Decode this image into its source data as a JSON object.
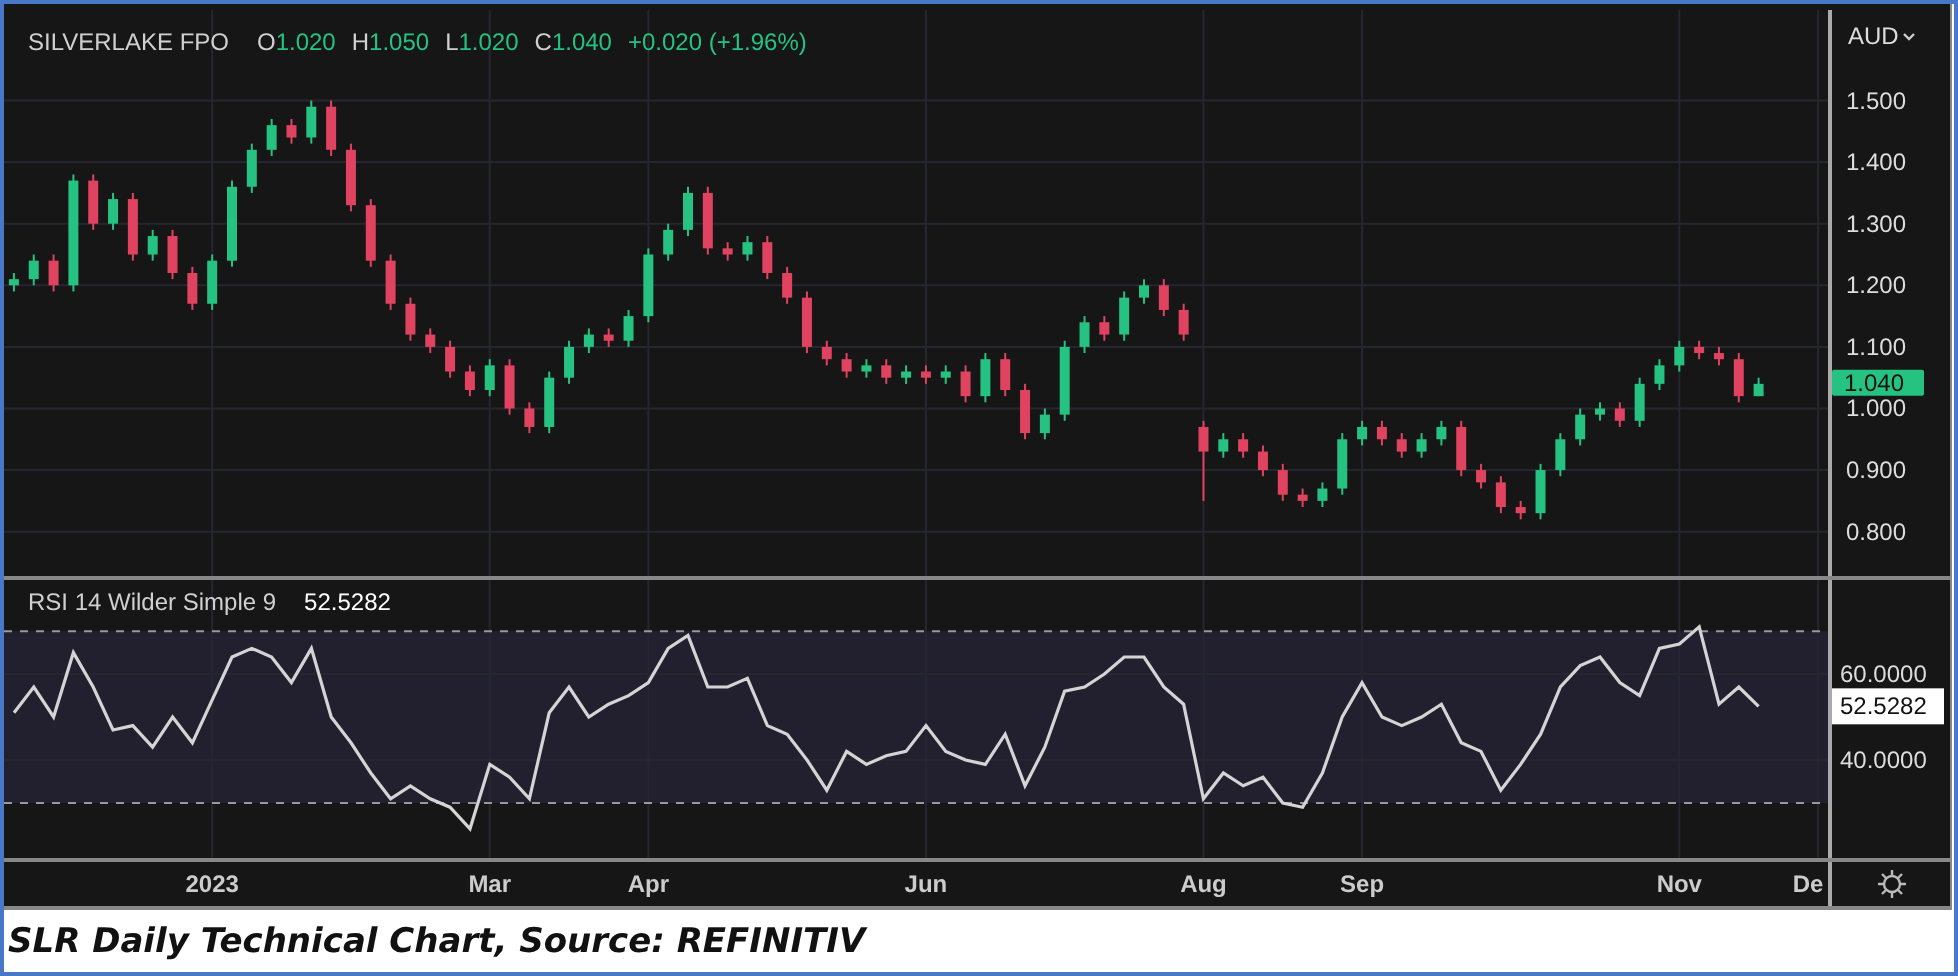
{
  "price_panel": {
    "symbol": "SILVERLAKE FPO",
    "ohlc": [
      {
        "label": "O",
        "value": "1.020"
      },
      {
        "label": "H",
        "value": "1.050"
      },
      {
        "label": "L",
        "value": "1.020"
      },
      {
        "label": "C",
        "value": "1.040"
      }
    ],
    "change": "+0.020 (+1.96%)",
    "currency": "AUD",
    "last_price": "1.040",
    "chart_data": {
      "type": "candlestick",
      "grid": true,
      "ylim": [
        0.728,
        1.647
      ],
      "yticks": [
        {
          "value": 0.8,
          "label": "0.800"
        },
        {
          "value": 0.9,
          "label": "0.900"
        },
        {
          "value": 1.0,
          "label": "1.000"
        },
        {
          "value": 1.1,
          "label": "1.100"
        },
        {
          "value": 1.2,
          "label": "1.200"
        },
        {
          "value": 1.3,
          "label": "1.300"
        },
        {
          "value": 1.4,
          "label": "1.400"
        },
        {
          "value": 1.5,
          "label": "1.500"
        }
      ],
      "categories": [
        null,
        null,
        null,
        null,
        null,
        null,
        null,
        null,
        null,
        null,
        null,
        null,
        null,
        null,
        null,
        null,
        null,
        null,
        null,
        null,
        null,
        null,
        null,
        null,
        null,
        null,
        null,
        null,
        null,
        null,
        null,
        null,
        null,
        null,
        null,
        null,
        null,
        null,
        null,
        null,
        null,
        null,
        null,
        null,
        null,
        null,
        null,
        null,
        null,
        null,
        null,
        null,
        null,
        null,
        null,
        null,
        null,
        null,
        null,
        null,
        null,
        null,
        null,
        null,
        null,
        null,
        null,
        null,
        null,
        null,
        null,
        null,
        null,
        null,
        null,
        null,
        null,
        null,
        null,
        null,
        null,
        null,
        null,
        null,
        null,
        null,
        null,
        null,
        null,
        null,
        null,
        null
      ],
      "ohlc": [
        [
          1.2,
          1.22,
          1.19,
          1.21
        ],
        [
          1.21,
          1.25,
          1.2,
          1.24
        ],
        [
          1.24,
          1.25,
          1.19,
          1.2
        ],
        [
          1.2,
          1.38,
          1.19,
          1.37
        ],
        [
          1.37,
          1.38,
          1.29,
          1.3
        ],
        [
          1.3,
          1.35,
          1.29,
          1.34
        ],
        [
          1.34,
          1.35,
          1.24,
          1.25
        ],
        [
          1.25,
          1.29,
          1.24,
          1.28
        ],
        [
          1.28,
          1.29,
          1.21,
          1.22
        ],
        [
          1.22,
          1.23,
          1.16,
          1.17
        ],
        [
          1.17,
          1.25,
          1.16,
          1.24
        ],
        [
          1.24,
          1.37,
          1.23,
          1.36
        ],
        [
          1.36,
          1.43,
          1.35,
          1.42
        ],
        [
          1.42,
          1.47,
          1.41,
          1.46
        ],
        [
          1.46,
          1.47,
          1.43,
          1.44
        ],
        [
          1.44,
          1.5,
          1.43,
          1.49
        ],
        [
          1.49,
          1.5,
          1.41,
          1.42
        ],
        [
          1.42,
          1.43,
          1.32,
          1.33
        ],
        [
          1.33,
          1.34,
          1.23,
          1.24
        ],
        [
          1.24,
          1.25,
          1.16,
          1.17
        ],
        [
          1.17,
          1.18,
          1.11,
          1.12
        ],
        [
          1.12,
          1.13,
          1.09,
          1.1
        ],
        [
          1.1,
          1.11,
          1.05,
          1.06
        ],
        [
          1.06,
          1.07,
          1.02,
          1.03
        ],
        [
          1.03,
          1.08,
          1.02,
          1.07
        ],
        [
          1.07,
          1.08,
          0.99,
          1.0
        ],
        [
          1.0,
          1.01,
          0.96,
          0.97
        ],
        [
          0.97,
          1.06,
          0.96,
          1.05
        ],
        [
          1.05,
          1.11,
          1.04,
          1.1
        ],
        [
          1.1,
          1.13,
          1.09,
          1.12
        ],
        [
          1.12,
          1.13,
          1.1,
          1.11
        ],
        [
          1.11,
          1.16,
          1.1,
          1.15
        ],
        [
          1.15,
          1.26,
          1.14,
          1.25
        ],
        [
          1.25,
          1.3,
          1.24,
          1.29
        ],
        [
          1.29,
          1.36,
          1.28,
          1.35
        ],
        [
          1.35,
          1.36,
          1.25,
          1.26
        ],
        [
          1.26,
          1.27,
          1.24,
          1.25
        ],
        [
          1.25,
          1.28,
          1.24,
          1.27
        ],
        [
          1.27,
          1.28,
          1.21,
          1.22
        ],
        [
          1.22,
          1.23,
          1.17,
          1.18
        ],
        [
          1.18,
          1.19,
          1.09,
          1.1
        ],
        [
          1.1,
          1.11,
          1.07,
          1.08
        ],
        [
          1.08,
          1.09,
          1.05,
          1.06
        ],
        [
          1.06,
          1.08,
          1.05,
          1.07
        ],
        [
          1.07,
          1.08,
          1.04,
          1.05
        ],
        [
          1.05,
          1.07,
          1.04,
          1.06
        ],
        [
          1.06,
          1.07,
          1.04,
          1.05
        ],
        [
          1.05,
          1.07,
          1.04,
          1.06
        ],
        [
          1.06,
          1.07,
          1.01,
          1.02
        ],
        [
          1.02,
          1.09,
          1.01,
          1.08
        ],
        [
          1.08,
          1.09,
          1.02,
          1.03
        ],
        [
          1.03,
          1.04,
          0.95,
          0.96
        ],
        [
          0.96,
          1.0,
          0.95,
          0.99
        ],
        [
          0.99,
          1.11,
          0.98,
          1.1
        ],
        [
          1.1,
          1.15,
          1.09,
          1.14
        ],
        [
          1.14,
          1.15,
          1.11,
          1.12
        ],
        [
          1.12,
          1.19,
          1.11,
          1.18
        ],
        [
          1.18,
          1.21,
          1.17,
          1.2
        ],
        [
          1.2,
          1.21,
          1.15,
          1.16
        ],
        [
          1.16,
          1.17,
          1.11,
          1.12
        ],
        [
          0.97,
          0.98,
          0.85,
          0.93
        ],
        [
          0.93,
          0.96,
          0.92,
          0.95
        ],
        [
          0.95,
          0.96,
          0.92,
          0.93
        ],
        [
          0.93,
          0.94,
          0.89,
          0.9
        ],
        [
          0.9,
          0.91,
          0.85,
          0.86
        ],
        [
          0.86,
          0.87,
          0.84,
          0.85
        ],
        [
          0.85,
          0.88,
          0.84,
          0.87
        ],
        [
          0.87,
          0.96,
          0.86,
          0.95
        ],
        [
          0.95,
          0.98,
          0.94,
          0.97
        ],
        [
          0.97,
          0.98,
          0.94,
          0.95
        ],
        [
          0.95,
          0.96,
          0.92,
          0.93
        ],
        [
          0.93,
          0.96,
          0.92,
          0.95
        ],
        [
          0.95,
          0.98,
          0.94,
          0.97
        ],
        [
          0.97,
          0.98,
          0.89,
          0.9
        ],
        [
          0.9,
          0.91,
          0.87,
          0.88
        ],
        [
          0.88,
          0.89,
          0.83,
          0.84
        ],
        [
          0.84,
          0.85,
          0.82,
          0.83
        ],
        [
          0.83,
          0.91,
          0.82,
          0.9
        ],
        [
          0.9,
          0.96,
          0.89,
          0.95
        ],
        [
          0.95,
          1.0,
          0.94,
          0.99
        ],
        [
          0.99,
          1.01,
          0.98,
          1.0
        ],
        [
          1.0,
          1.01,
          0.97,
          0.98
        ],
        [
          0.98,
          1.05,
          0.97,
          1.04
        ],
        [
          1.04,
          1.08,
          1.03,
          1.07
        ],
        [
          1.07,
          1.11,
          1.06,
          1.1
        ],
        [
          1.1,
          1.11,
          1.08,
          1.09
        ],
        [
          1.09,
          1.1,
          1.07,
          1.08
        ],
        [
          1.08,
          1.09,
          1.01,
          1.02
        ],
        [
          1.02,
          1.05,
          1.02,
          1.04
        ],
        null,
        null,
        null
      ]
    }
  },
  "rsi_panel": {
    "title": "RSI 14 Wilder Simple 9",
    "reading": "52.5282",
    "last_value": "52.5282",
    "chart_data": {
      "type": "line",
      "grid": true,
      "ylim": [
        17.2,
        81.9
      ],
      "yticks": [
        {
          "value": 40,
          "label": "40.0000"
        },
        {
          "value": 60,
          "label": "60.0000"
        }
      ],
      "categories": [
        null,
        null,
        null,
        null,
        null,
        null,
        null,
        null,
        null,
        null,
        "2023",
        null,
        null,
        null,
        null,
        null,
        null,
        null,
        null,
        null,
        null,
        null,
        null,
        null,
        "Mar",
        null,
        null,
        null,
        null,
        null,
        null,
        null,
        "Apr",
        null,
        null,
        null,
        null,
        null,
        null,
        null,
        null,
        null,
        null,
        null,
        null,
        null,
        "Jun",
        null,
        null,
        null,
        null,
        null,
        null,
        null,
        null,
        null,
        null,
        null,
        null,
        null,
        "Aug",
        null,
        null,
        null,
        null,
        null,
        null,
        null,
        "Sep",
        null,
        null,
        null,
        null,
        null,
        null,
        null,
        null,
        null,
        null,
        null,
        null,
        null,
        null,
        null,
        "Nov",
        null,
        null,
        null,
        null,
        null,
        null,
        "De"
      ],
      "bands": [
        {
          "axis": "y",
          "from": 30,
          "to": 70
        }
      ],
      "ref_lines": [
        {
          "axis": "y",
          "value": 70
        },
        {
          "axis": "y",
          "value": 30
        }
      ],
      "series": [
        {
          "color": "#d4d4d4",
          "values": [
            51,
            57,
            50,
            65,
            57,
            47,
            48,
            43,
            50,
            44,
            54,
            64,
            66,
            64,
            58,
            66,
            50,
            44,
            37,
            31,
            34,
            31,
            29,
            24,
            39,
            36,
            31,
            51,
            57,
            50,
            53,
            55,
            58,
            66,
            69,
            57,
            57,
            59,
            48,
            46,
            40,
            33,
            42,
            39,
            41,
            42,
            48,
            42,
            40,
            39,
            46,
            34,
            43,
            56,
            57,
            60,
            64,
            64,
            57,
            53,
            31,
            37,
            34,
            36,
            30,
            29,
            37,
            50,
            58,
            50,
            48,
            50,
            53,
            44,
            42,
            33,
            39,
            46,
            57,
            62,
            64,
            58,
            55,
            66,
            67,
            71,
            53,
            57,
            52.5,
            null,
            null,
            null
          ]
        }
      ]
    }
  },
  "caption": "SLR Daily Technical Chart, Source: REFINITIV"
}
